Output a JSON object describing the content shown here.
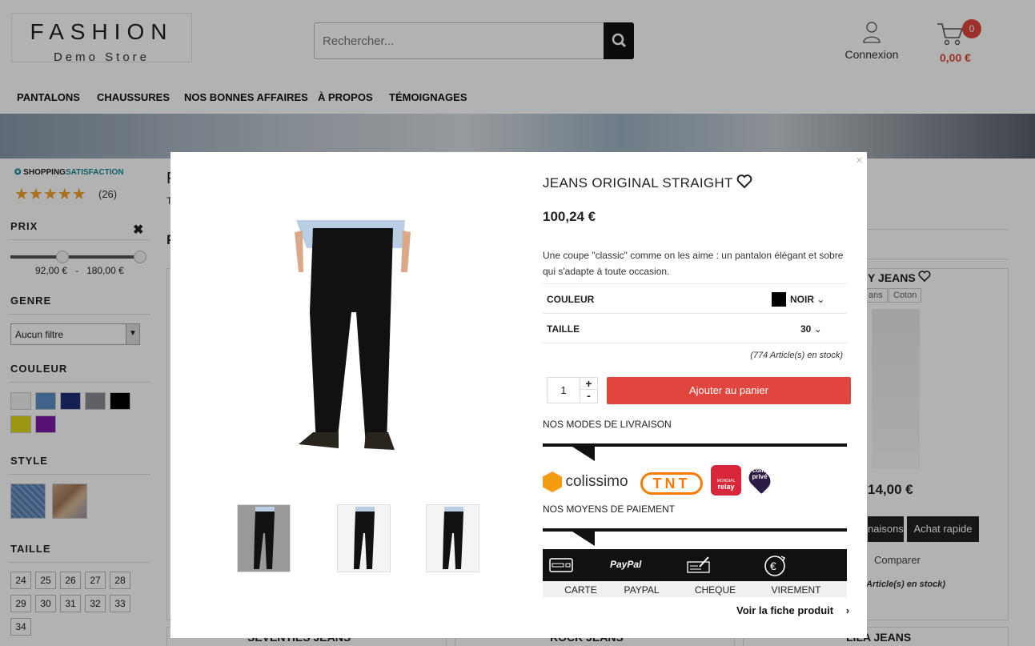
{
  "header": {
    "logo_line1": "FASHION",
    "logo_line2": "Demo Store",
    "search_placeholder": "Rechercher...",
    "login_label": "Connexion",
    "cart_count": "0",
    "cart_total": "0,00 €"
  },
  "nav": [
    "PANTALONS",
    "CHAUSSURES",
    "NOS BONNES AFFAIRES",
    "À PROPOS",
    "TÉMOIGNAGES"
  ],
  "sidebar": {
    "shopping_badge_a": "SHOPPING",
    "shopping_badge_b": "SATISFACTION",
    "rating_count": "(26)",
    "prix_title": "PRIX",
    "price_min": "92,00 €",
    "price_sep": "-",
    "price_max": "180,00 €",
    "genre_title": "GENRE",
    "genre_selected": "Aucun filtre",
    "couleur_title": "COULEUR",
    "colors": [
      "#f2f2f2",
      "#5b8fc7",
      "#1f2f7a",
      "#888c94",
      "#000000",
      "#e0d81a",
      "#7a19a8"
    ],
    "style_title": "STYLE",
    "taille_title": "TAILLE",
    "sizes": [
      "24",
      "25",
      "26",
      "27",
      "28",
      "29",
      "30",
      "31",
      "32",
      "33",
      "34"
    ]
  },
  "background": {
    "partial_heading": "F",
    "partial_sub": "T",
    "partial_heading2": "F",
    "product_right_name": "Y JEANS",
    "tag1": "ans",
    "tag2": "Coton",
    "price_right": "14,00 €",
    "btn_declinaisons": "naisons",
    "btn_quick": "Achat rapide",
    "compare": "Comparer",
    "stock_right": "Article(s) en stock)",
    "bottom1": "SEVENTIES JEANS",
    "bottom2": "ROCK JEANS",
    "bottom3": "LILA JEANS"
  },
  "modal": {
    "close": "×",
    "title": "JEANS ORIGINAL STRAIGHT",
    "price": "100,24 €",
    "description": "Une coupe \"classic\" comme on les aime : un pantalon élégant et sobre qui s'adapte à toute occasion.",
    "color_label": "COULEUR",
    "color_value": "NOIR",
    "size_label": "TAILLE",
    "size_value": "30",
    "stock": "(774 Article(s) en stock)",
    "quantity": "1",
    "plus": "+",
    "minus": "-",
    "add_to_cart": "Ajouter au panier",
    "delivery_title": "NOS MODES DE LIVRAISON",
    "carrier_colissimo": "colissimo",
    "carrier_tnt": "TNT",
    "carrier_relay_a": "MONDIAL",
    "carrier_relay_b": "relay",
    "carrier_colis_a": "colis",
    "carrier_colis_b": "privé",
    "payment_title": "NOS MOYENS DE PAIEMENT",
    "paypal_logo": "PayPal",
    "payments": [
      "CARTE",
      "PAYPAL",
      "CHEQUE",
      "VIREMENT"
    ],
    "view_product": "Voir la fiche produit"
  },
  "colors": {
    "accent": "#e0463e",
    "star": "#f0a32c",
    "dark": "#111111"
  }
}
